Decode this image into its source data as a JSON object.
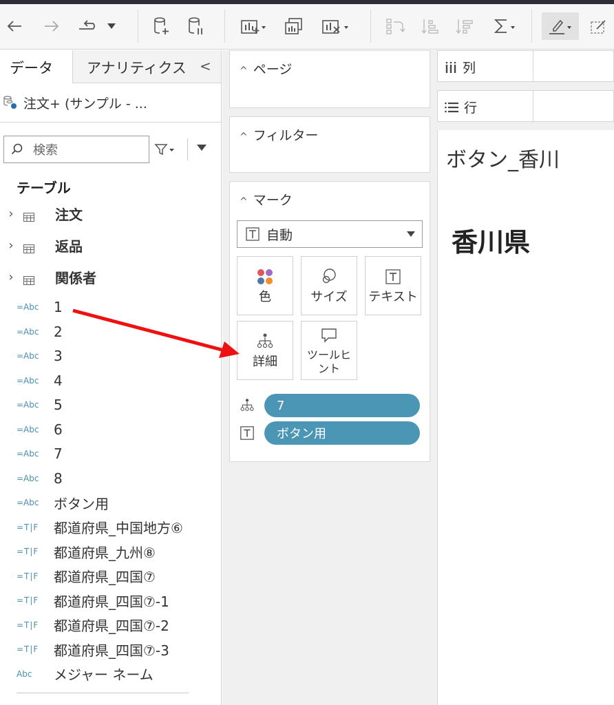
{
  "toolbar": {
    "icons": [
      "back-icon",
      "forward-icon",
      "redo-icon",
      "redo-dropdown-icon",
      "new-datasource-icon",
      "pause-update-icon",
      "new-worksheet-icon",
      "duplicate-sheet-icon",
      "clear-sheet-icon",
      "swap-icon",
      "sort-ascending-icon",
      "sort-descending-icon",
      "totals-icon",
      "highlight-icon",
      "group-icon"
    ]
  },
  "left": {
    "tab_data": "データ",
    "tab_analytics": "アナリティクス",
    "collapse": "<",
    "datasource": "注文+ (サンプル - ...",
    "search_placeholder": "検索",
    "tables_heading": "テーブル",
    "tables": [
      {
        "label": "注文"
      },
      {
        "label": "返品"
      },
      {
        "label": "関係者"
      }
    ],
    "fields": [
      {
        "type": "=Abc",
        "label": "1"
      },
      {
        "type": "=Abc",
        "label": "2"
      },
      {
        "type": "=Abc",
        "label": "3"
      },
      {
        "type": "=Abc",
        "label": "4"
      },
      {
        "type": "=Abc",
        "label": "5"
      },
      {
        "type": "=Abc",
        "label": "6"
      },
      {
        "type": "=Abc",
        "label": "7"
      },
      {
        "type": "=Abc",
        "label": "8"
      },
      {
        "type": "=Abc",
        "label": "ボタン用"
      },
      {
        "type": "=T|F",
        "label": "都道府県_中国地方⑥"
      },
      {
        "type": "=T|F",
        "label": "都道府県_九州⑧"
      },
      {
        "type": "=T|F",
        "label": "都道府県_四国⑦"
      },
      {
        "type": "=T|F",
        "label": "都道府県_四国⑦-1"
      },
      {
        "type": "=T|F",
        "label": "都道府県_四国⑦-2"
      },
      {
        "type": "=T|F",
        "label": "都道府県_四国⑦-3"
      },
      {
        "type": "Abc",
        "label": "メジャー ネーム"
      }
    ]
  },
  "shelves": {
    "pages": "ページ",
    "filters": "フィルター",
    "marks": "マーク",
    "mark_type": "自動",
    "buttons": {
      "color": "色",
      "size": "サイズ",
      "text": "テキスト",
      "detail": "詳細",
      "tooltip": "ツールヒント"
    },
    "pills": [
      {
        "icon": "detail-icon",
        "label": "7"
      },
      {
        "icon": "text-icon",
        "label": "ボタン用"
      }
    ],
    "pill_color": "#4b96b4"
  },
  "canvas": {
    "columns_label": "列",
    "rows_label": "行",
    "header": "ボタン_香川",
    "value": "香川県"
  },
  "annotation": {
    "arrow_color": "#ee1111"
  }
}
